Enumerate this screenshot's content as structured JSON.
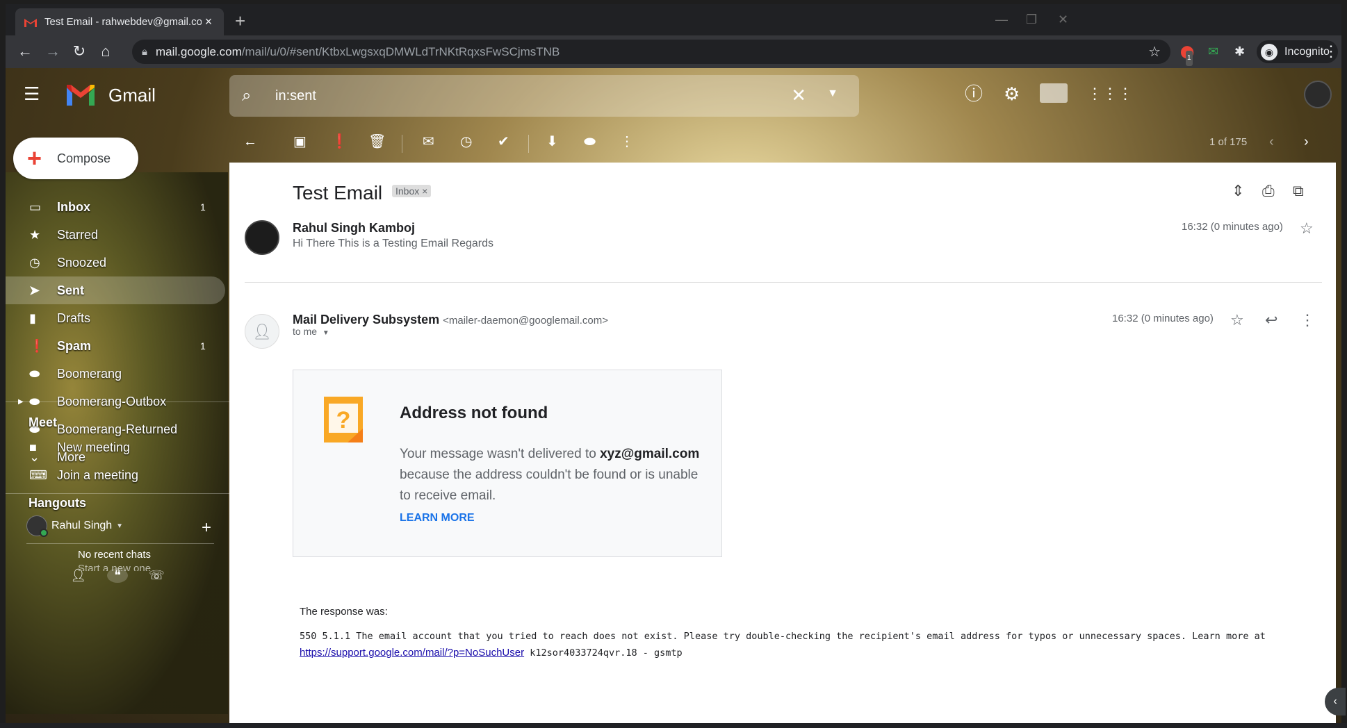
{
  "browser": {
    "tab_title": "Test Email - rahwebdev@gmail.com",
    "tab_close": "×",
    "new_tab": "+",
    "url_host": "mail.google.com",
    "url_path": "/mail/u/0/#sent/KtbxLwgsxqDMWLdTrNKtRqxsFwSCjmsTNB",
    "incognito_label": "Incognito",
    "extension_badge": "1"
  },
  "gmail": {
    "brand": "Gmail",
    "search_value": "in:sent",
    "compose_label": "Compose",
    "nav": [
      {
        "label": "Inbox",
        "count": "1",
        "icon": "inbox-icon"
      },
      {
        "label": "Starred",
        "count": "",
        "icon": "star-icon"
      },
      {
        "label": "Snoozed",
        "count": "",
        "icon": "clock-icon"
      },
      {
        "label": "Sent",
        "count": "",
        "icon": "send-icon"
      },
      {
        "label": "Drafts",
        "count": "",
        "icon": "draft-icon"
      },
      {
        "label": "Spam",
        "count": "1",
        "icon": "spam-icon"
      },
      {
        "label": "Boomerang",
        "count": "",
        "icon": "label-icon"
      },
      {
        "label": "Boomerang-Outbox",
        "count": "",
        "icon": "label-icon"
      },
      {
        "label": "Boomerang-Returned",
        "count": "",
        "icon": "label-icon"
      },
      {
        "label": "More",
        "count": "",
        "icon": "chevron-down-icon"
      }
    ],
    "meet": {
      "heading": "Meet",
      "new_meeting": "New meeting",
      "join_meeting": "Join a meeting"
    },
    "hangouts": {
      "heading": "Hangouts",
      "user": "Rahul Singh",
      "no_chats": "No recent chats",
      "start_new": "Start a new one"
    },
    "pager": "1 of 175"
  },
  "thread": {
    "subject": "Test Email",
    "label": "Inbox",
    "label_remove": "×",
    "messages": [
      {
        "sender": "Rahul Singh Kamboj",
        "snippet": "Hi There This is a Testing Email Regards",
        "time": "16:32 (0 minutes ago)"
      },
      {
        "sender": "Mail Delivery Subsystem",
        "email": "<mailer-daemon@googlemail.com>",
        "to": "to me",
        "time": "16:32 (0 minutes ago)"
      }
    ],
    "bounce": {
      "title": "Address not found",
      "body_pre": "Your message wasn't delivered to ",
      "address": "xyz@gmail.com",
      "body_post": " because the address couldn't be found or is unable to receive email.",
      "learn_more": "LEARN MORE"
    },
    "response_label": "The response was:",
    "response_pre": "550 5.1.1 The email account that you tried to reach does not exist. Please try double-checking the recipient's email address for typos or unnecessary spaces. Learn more at ",
    "response_link": "https://support.google.com/mail/?p=NoSuchUser",
    "response_post": " k12sor4033724qvr.18 - gsmtp"
  },
  "colors": {
    "gmail_red": "#ea4335",
    "link_blue": "#1a73e8",
    "chrome_dark": "#35363a"
  }
}
